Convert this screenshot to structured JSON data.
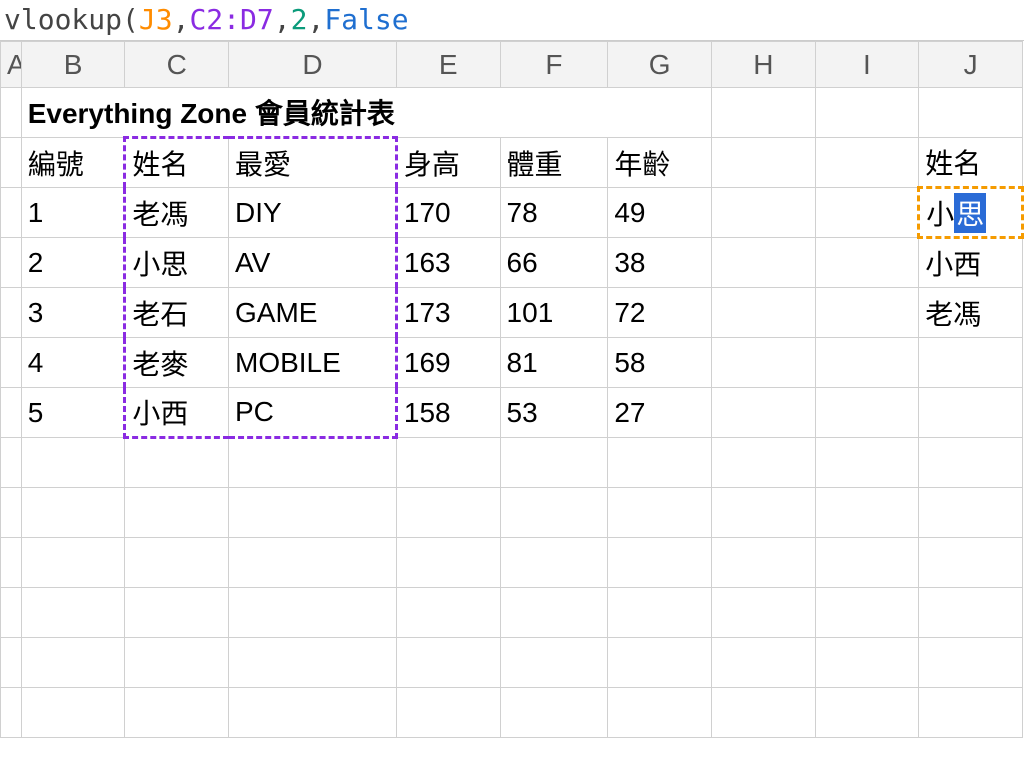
{
  "formula_bar": {
    "prefix": "vlookup(",
    "ref1": "J3",
    "comma1": ",",
    "ref2": "C2:D7",
    "comma2": ",",
    "col_index": "2",
    "comma3": ",",
    "match": "False"
  },
  "column_letters": [
    "A",
    "B",
    "C",
    "D",
    "E",
    "F",
    "G",
    "H",
    "I",
    "J"
  ],
  "title": "Everything Zone 會員統計表",
  "headers": {
    "id": "編號",
    "name": "姓名",
    "fav": "最愛",
    "height": "身高",
    "weight": "體重",
    "age": "年齡"
  },
  "rows": [
    {
      "id": "1",
      "name": "老馮",
      "fav": "DIY",
      "height": "170",
      "weight": "78",
      "age": "49"
    },
    {
      "id": "2",
      "name": "小思",
      "fav": "AV",
      "height": "163",
      "weight": "66",
      "age": "38"
    },
    {
      "id": "3",
      "name": "老石",
      "fav": "GAME",
      "height": "173",
      "weight": "101",
      "age": "72"
    },
    {
      "id": "4",
      "name": "老麥",
      "fav": "MOBILE",
      "height": "169",
      "weight": "81",
      "age": "58"
    },
    {
      "id": "5",
      "name": "小西",
      "fav": "PC",
      "height": "158",
      "weight": "53",
      "age": "27"
    }
  ],
  "side": {
    "header": "姓名",
    "cells": {
      "j3_visible": "小",
      "j3_selected": "思",
      "j4": "小西",
      "j5": "老馮"
    }
  }
}
